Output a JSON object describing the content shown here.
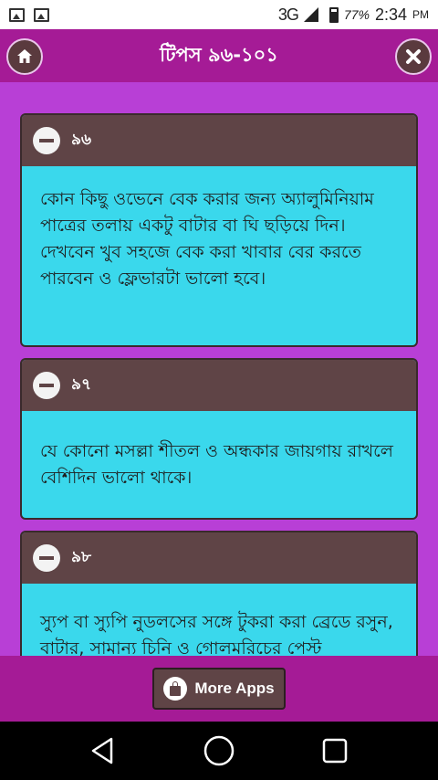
{
  "status_bar": {
    "network": "3G",
    "battery": "77%",
    "time": "2:34",
    "ampm": "PM"
  },
  "header": {
    "title": "টিপস ৯৬-১০১"
  },
  "cards": [
    {
      "number": "৯৬",
      "text": "কোন কিছু ওভেনে বেক করার জন্য অ্যালুমিনিয়াম পাত্রের তলায় একটু বাটার বা ঘি ছড়িয়ে দিন। দেখবেন খুব সহজে বেক করা খাবার বের করতে পারবেন ও ফ্লেভারটা ভালো হবে।"
    },
    {
      "number": "৯৭",
      "text": "যে কোনো মসল্লা শীতল ও অন্ধকার জায়গায় রাখলে বেশিদিন ভালো থাকে।"
    },
    {
      "number": "৯৮",
      "text": "স্যুপ বা স্যুপি নুডলসের সঙ্গে টুকরা করা ব্রেডে রসুন, বাটার, সামান্য চিনি ও গোলমরিচের পেস্ট"
    }
  ],
  "footer": {
    "more_apps_label": "More Apps"
  },
  "icons": {
    "home": "home-icon",
    "close": "close-icon",
    "bag": "shopping-bag-icon",
    "back": "back-triangle-icon",
    "home_nav": "home-circle-icon",
    "recents": "recents-square-icon"
  },
  "colors": {
    "background": "#b83fd6",
    "header": "#a51b96",
    "card_head": "#5f4446",
    "card_body": "#3ad8ec"
  }
}
